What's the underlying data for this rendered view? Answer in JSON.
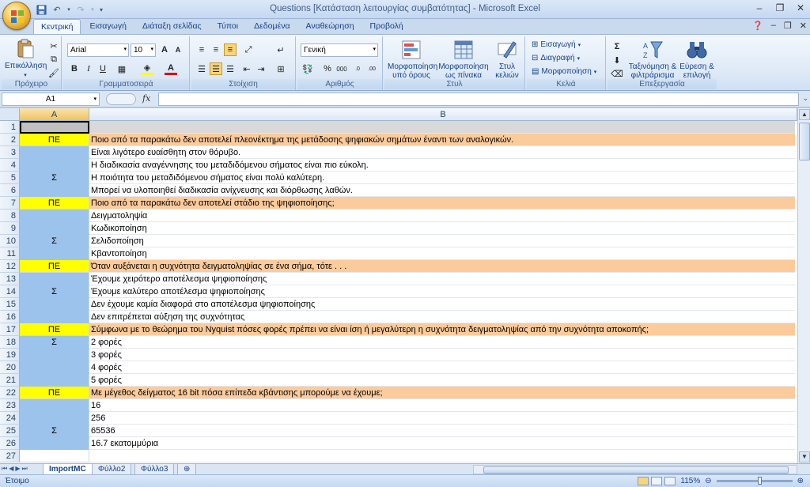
{
  "window": {
    "title": "Questions  [Κατάσταση λειτουργίας συμβατότητας] - Microsoft Excel"
  },
  "ribbon": {
    "tabs": [
      "Κεντρική",
      "Εισαγωγή",
      "Διάταξη σελίδας",
      "Τύποι",
      "Δεδομένα",
      "Αναθεώρηση",
      "Προβολή"
    ],
    "active_tab": "Κεντρική",
    "clipboard": {
      "paste": "Επικόλληση",
      "label": "Πρόχειρο"
    },
    "font": {
      "name": "Arial",
      "size": "10",
      "label": "Γραμματοσειρά"
    },
    "alignment": {
      "label": "Στοίχιση"
    },
    "number": {
      "format": "Γενική",
      "label": "Αριθμός"
    },
    "styles": {
      "conditional": "Μορφοποίηση υπό όρους",
      "as_table": "Μορφοποίηση ως πίνακα",
      "cell_styles": "Στυλ κελιών",
      "label": "Στυλ"
    },
    "cells": {
      "insert": "Εισαγωγή",
      "delete": "Διαγραφή",
      "format": "Μορφοποίηση",
      "label": "Κελιά"
    },
    "editing": {
      "sort": "Ταξινόμηση & φιλτράρισμα",
      "find": "Εύρεση & επιλογή",
      "label": "Επεξεργασία"
    }
  },
  "formula_bar": {
    "name_box": "A1",
    "fx": "fx",
    "content": ""
  },
  "grid": {
    "columns": [
      "A",
      "B"
    ],
    "rows": [
      {
        "n": "1",
        "a": "",
        "b": "",
        "type": "sel"
      },
      {
        "n": "2",
        "a": "ΠΕ",
        "b": "Ποιο από τα παρακάτω δεν αποτελεί πλεονέκτημα της μετάδοσης ψηφιακών σημάτων έναντι των αναλογικών.",
        "type": "q"
      },
      {
        "n": "3",
        "a": "",
        "b": "Είναι λιγότερο ευαίσθητη στον θόρυβο.",
        "type": "ans"
      },
      {
        "n": "4",
        "a": "",
        "b": "Η διαδικασία αναγέννησης του μεταδιδόμενου σήματος είναι πιο εύκολη.",
        "type": "ans"
      },
      {
        "n": "5",
        "a": "Σ",
        "b": "Η ποιότητα του μεταδιδόμενου σήματος είναι πολύ καλύτερη.",
        "type": "ans"
      },
      {
        "n": "6",
        "a": "",
        "b": "Μπορεί να υλοποιηθεί διαδικασία ανίχνευσης και διόρθωσης λαθών.",
        "type": "ans"
      },
      {
        "n": "7",
        "a": "ΠΕ",
        "b": "Ποιο από τα παρακάτω δεν αποτελεί στάδιο της ψηφιοποίησης;",
        "type": "q"
      },
      {
        "n": "8",
        "a": "",
        "b": "Δειγματοληψία",
        "type": "ans"
      },
      {
        "n": "9",
        "a": "",
        "b": "Κωδικοποίηση",
        "type": "ans"
      },
      {
        "n": "10",
        "a": "Σ",
        "b": "Σελιδοποίηση",
        "type": "ans"
      },
      {
        "n": "11",
        "a": "",
        "b": "Κβαντοποίηση",
        "type": "ans"
      },
      {
        "n": "12",
        "a": "ΠΕ",
        "b": "Όταν αυξάνεται η συχνότητα δειγματοληψίας σε ένα σήμα, τότε . . .",
        "type": "q"
      },
      {
        "n": "13",
        "a": "",
        "b": "Έχουμε χειρότερο αποτέλεσμα ψηφιοποίησης",
        "type": "ans"
      },
      {
        "n": "14",
        "a": "Σ",
        "b": "Έχουμε καλύτερο αποτέλεσμα ψηφιοποίησης",
        "type": "ans"
      },
      {
        "n": "15",
        "a": "",
        "b": "Δεν έχουμε καμία διαφορά στο αποτέλεσμα ψηφιοποίησης",
        "type": "ans"
      },
      {
        "n": "16",
        "a": "",
        "b": "Δεν επιτρέπεται αύξηση της συχνότητας",
        "type": "ans"
      },
      {
        "n": "17",
        "a": "ΠΕ",
        "b": "Σύμφωνα με το θεώρημα του Nyquist πόσες φορές πρέπει να είναι ίση ή μεγαλύτερη η συχνότητα δειγματοληψίας από την συχνότητα αποκοπής;",
        "type": "q"
      },
      {
        "n": "18",
        "a": "Σ",
        "b": "2 φορές",
        "type": "ans"
      },
      {
        "n": "19",
        "a": "",
        "b": "3 φορές",
        "type": "ans"
      },
      {
        "n": "20",
        "a": "",
        "b": "4 φορές",
        "type": "ans"
      },
      {
        "n": "21",
        "a": "",
        "b": "5 φορές",
        "type": "ans"
      },
      {
        "n": "22",
        "a": "ΠΕ",
        "b": "Με μέγεθος δείγματος 16 bit πόσα επίπεδα κβάντισης μπορούμε να έχουμε;",
        "type": "q"
      },
      {
        "n": "23",
        "a": "",
        "b": "16",
        "type": "ans"
      },
      {
        "n": "24",
        "a": "",
        "b": "256",
        "type": "ans"
      },
      {
        "n": "25",
        "a": "Σ",
        "b": "65536",
        "type": "ans"
      },
      {
        "n": "26",
        "a": "",
        "b": "16.7 εκατομμύρια",
        "type": "ans"
      },
      {
        "n": "27",
        "a": "",
        "b": "",
        "type": "plain"
      }
    ]
  },
  "sheets": [
    "ImportMC",
    "Φύλλο2",
    "Φύλλο3"
  ],
  "active_sheet": "ImportMC",
  "status": {
    "ready": "Έτοιμο",
    "zoom": "115%"
  },
  "colors": {
    "question_a": "#ffff00",
    "question_b": "#fbcb9b",
    "answer_a": "#9cc3eb"
  }
}
